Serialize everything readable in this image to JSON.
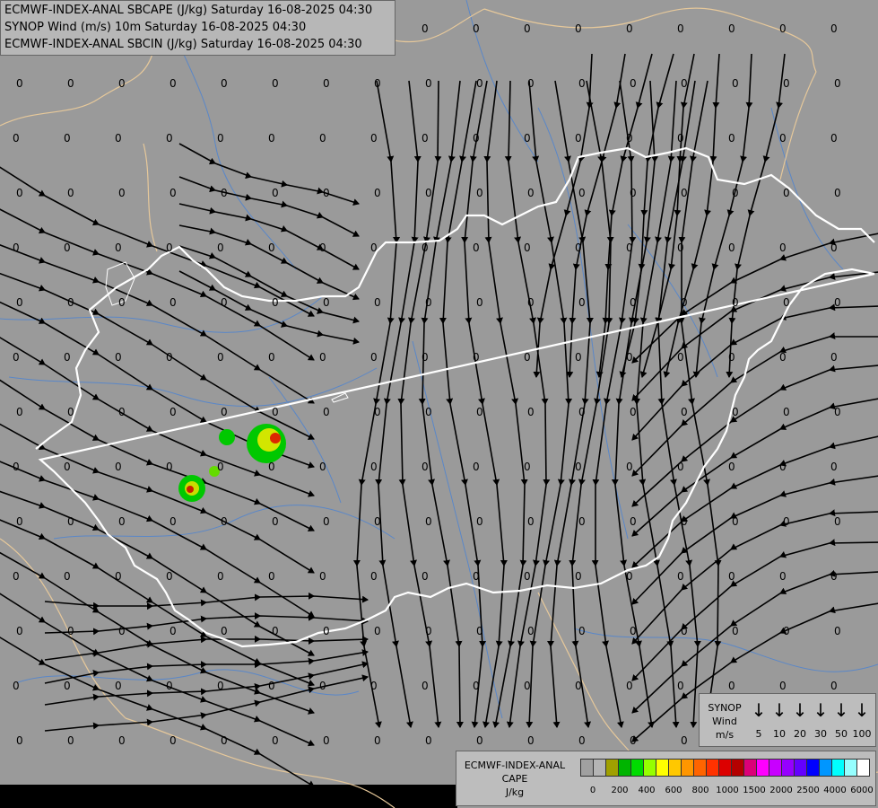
{
  "titles": {
    "line1": "ECMWF-INDEX-ANAL SBCAPE (J/kg) Saturday 16-08-2025 04:30",
    "line2": "SYNOP Wind (m/s) 10m Saturday 16-08-2025 04:30",
    "line3": "ECMWF-INDEX-ANAL SBCIN (J/kg) Saturday 16-08-2025 04:30"
  },
  "wind_legend": {
    "title": "SYNOP",
    "line2": "Wind",
    "unit": "m/s",
    "speeds": [
      "5",
      "10",
      "20",
      "30",
      "50",
      "100"
    ]
  },
  "cape_legend": {
    "title": "ECMWF-INDEX-ANAL",
    "line2": "CAPE",
    "unit": "J/kg",
    "ticks": [
      "0",
      "200",
      "400",
      "600",
      "800",
      "1000",
      "1500",
      "2000",
      "2500",
      "4000",
      "6000"
    ],
    "colors": [
      "#a0a0a0",
      "#b4b4b4",
      "#a0a000",
      "#00b400",
      "#00dc00",
      "#96ff00",
      "#ffff00",
      "#ffc800",
      "#ff9600",
      "#ff6400",
      "#ff3200",
      "#dc0000",
      "#b40000",
      "#dc0078",
      "#ff00ff",
      "#c800ff",
      "#9600ff",
      "#6400ff",
      "#0000ff",
      "#0096ff",
      "#00ffff",
      "#96ffff",
      "#ffffff"
    ]
  },
  "value_label": "0",
  "colors": {
    "background": "#9a9a9a",
    "border": "#ffffff",
    "rivers": "#5a87c8",
    "outer_borders": "#e6c89a",
    "streamlines": "#000000"
  }
}
